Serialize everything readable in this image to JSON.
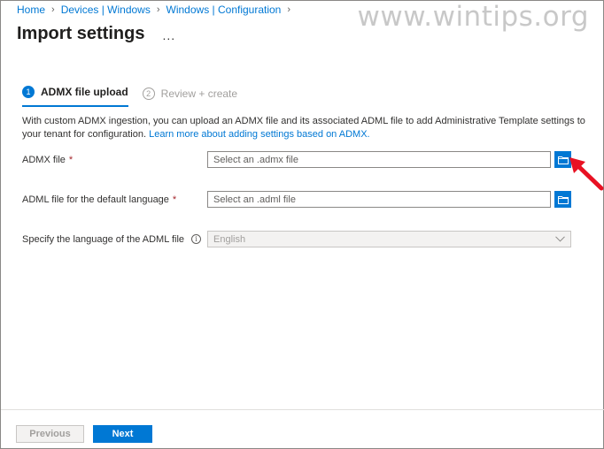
{
  "breadcrumb": [
    "Home",
    "Devices | Windows",
    "Windows | Configuration"
  ],
  "watermark": "www.wintips.org",
  "header": {
    "title": "Import settings",
    "more": "..."
  },
  "steps": [
    {
      "number": "1",
      "label": "ADMX file upload",
      "active": true
    },
    {
      "number": "2",
      "label": "Review + create",
      "active": false
    }
  ],
  "description": {
    "text": "With custom ADMX ingestion, you can upload an ADMX file and its associated ADML file to add Administrative Template settings to your tenant for configuration. ",
    "link": "Learn more about adding settings based on ADMX."
  },
  "fields": {
    "admx": {
      "label": "ADMX file",
      "required": "*",
      "placeholder": "Select an .admx file"
    },
    "adml": {
      "label": "ADML file for the default language",
      "required": "*",
      "placeholder": "Select an .adml file"
    },
    "language": {
      "label": "Specify the language of the ADML file",
      "info": "i",
      "value": "English"
    }
  },
  "footer": {
    "previous": "Previous",
    "next": "Next"
  },
  "colors": {
    "accent": "#0078d4",
    "required": "#a4262c",
    "annotation_arrow": "#e81123"
  }
}
